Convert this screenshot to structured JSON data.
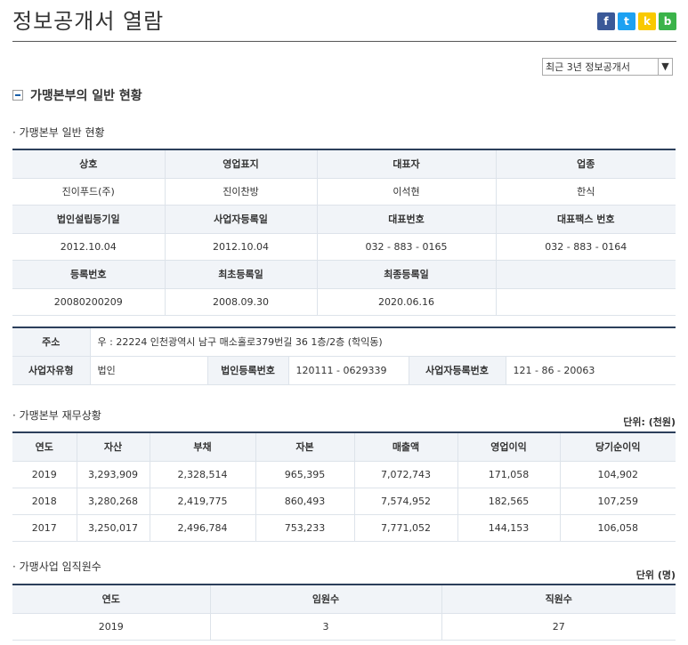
{
  "page_title": "정보공개서 열람",
  "social": {
    "facebook": "f",
    "twitter": "t",
    "kakao": "k",
    "band": "b"
  },
  "year_select": {
    "value": "최근 3년 정보공개서"
  },
  "section_title": "가맹본부의 일반 현황",
  "general": {
    "title": "가맹본부 일반 현황",
    "row1_headers": [
      "상호",
      "영업표지",
      "대표자",
      "업종"
    ],
    "row1_values": [
      "진이푸드(주)",
      "진이찬방",
      "이석현",
      "한식"
    ],
    "row2_headers": [
      "법인설립등기일",
      "사업자등록일",
      "대표번호",
      "대표팩스 번호"
    ],
    "row2_values": [
      "2012.10.04",
      "2012.10.04",
      "032 - 883 - 0165",
      "032 - 883 - 0164"
    ],
    "row3_headers": [
      "등록번호",
      "최초등록일",
      "최종등록일",
      ""
    ],
    "row3_values": [
      "20080200209",
      "2008.09.30",
      "2020.06.16",
      ""
    ]
  },
  "address": {
    "address_label": "주소",
    "address_value": "우 : 22224 인천광역시 남구 매소홀로379번길 36 1층/2층 (학익동)",
    "biz_type_label": "사업자유형",
    "biz_type_value": "법인",
    "corp_no_label": "법인등록번호",
    "corp_no_value": "120111 - 0629339",
    "biz_no_label": "사업자등록번호",
    "biz_no_value": "121 - 86 - 20063"
  },
  "finance": {
    "title": "가맹본부 재무상황",
    "unit": "단위: (천원)",
    "headers": [
      "연도",
      "자산",
      "부채",
      "자본",
      "매출액",
      "영업이익",
      "당기순이익"
    ],
    "rows": [
      [
        "2019",
        "3,293,909",
        "2,328,514",
        "965,395",
        "7,072,743",
        "171,058",
        "104,902"
      ],
      [
        "2018",
        "3,280,268",
        "2,419,775",
        "860,493",
        "7,574,952",
        "182,565",
        "107,259"
      ],
      [
        "2017",
        "3,250,017",
        "2,496,784",
        "753,233",
        "7,771,052",
        "144,153",
        "106,058"
      ]
    ]
  },
  "staff": {
    "title": "가맹사업 임직원수",
    "unit": "단위 (명)",
    "headers": [
      "연도",
      "임원수",
      "직원수"
    ],
    "rows": [
      [
        "2019",
        "3",
        "27"
      ]
    ]
  }
}
